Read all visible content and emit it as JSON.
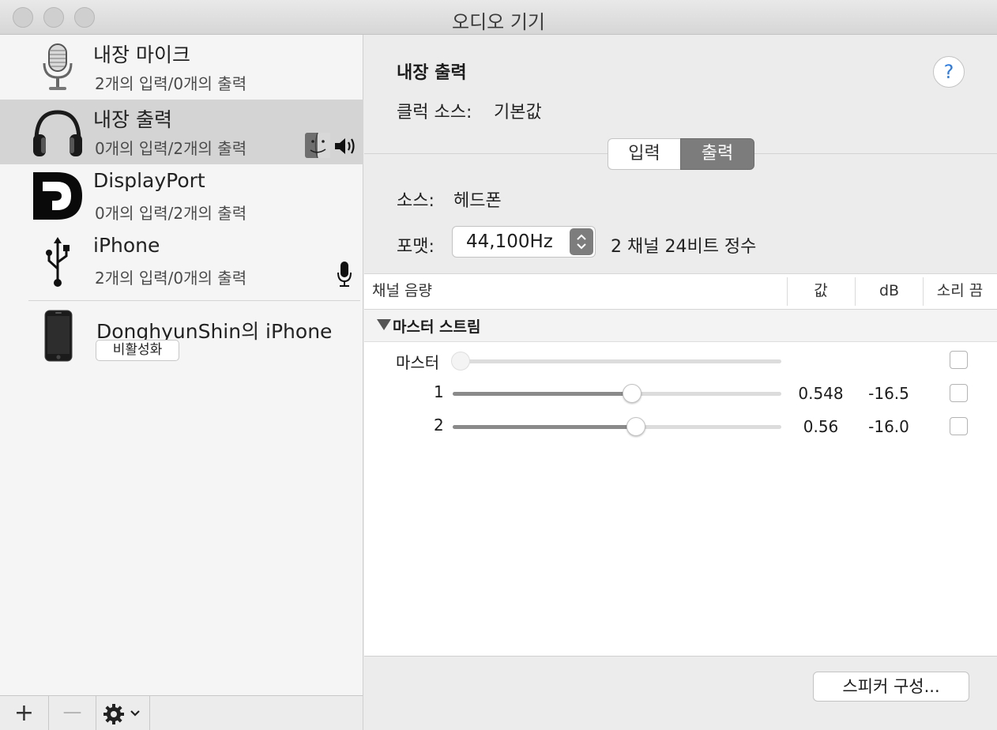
{
  "window": {
    "title": "오디오 기기"
  },
  "sidebar": {
    "devices": [
      {
        "name": "내장 마이크",
        "sub": "2개의 입력/0개의 출력",
        "icon": "microphone-icon"
      },
      {
        "name": "내장 출력",
        "sub": "0개의 입력/2개의 출력",
        "icon": "headphones-icon",
        "selected": true
      },
      {
        "name": "DisplayPort",
        "sub": "0개의 입력/2개의 출력",
        "icon": "displayport-icon"
      },
      {
        "name": "iPhone",
        "sub": "2개의 입력/0개의 출력",
        "icon": "usb-icon"
      },
      {
        "name": "DonghyunShin의 iPhone",
        "action": "비활성화",
        "icon": "iphone-icon"
      }
    ],
    "toolbar": {
      "add": "+",
      "remove": "—"
    }
  },
  "detail": {
    "title": "내장 출력",
    "clock_label": "클럭 소스:",
    "clock_value": "기본값",
    "help": "?",
    "tabs": {
      "input": "입력",
      "output": "출력",
      "selected": "output"
    },
    "source_label": "소스:",
    "source_value": "헤드폰",
    "format_label": "포맷:",
    "format_value": "44,100Hz",
    "format_desc": "2 채널 24비트 정수",
    "table": {
      "headers": {
        "channel": "채널 음량",
        "value": "값",
        "db": "dB",
        "mute": "소리 끔"
      },
      "group": "마스터 스트림",
      "rows": [
        {
          "label": "마스터",
          "level": 0.0,
          "value": "",
          "db": "",
          "muted": false,
          "disabled": true
        },
        {
          "label": "1",
          "level": 0.548,
          "value": "0.548",
          "db": "-16.5",
          "muted": false
        },
        {
          "label": "2",
          "level": 0.56,
          "value": "0.56",
          "db": "-16.0",
          "muted": false
        }
      ]
    },
    "speaker_button": "스피커 구성..."
  },
  "colors": {
    "accent": "#2a7ce3",
    "selection": "#d4d4d4"
  }
}
